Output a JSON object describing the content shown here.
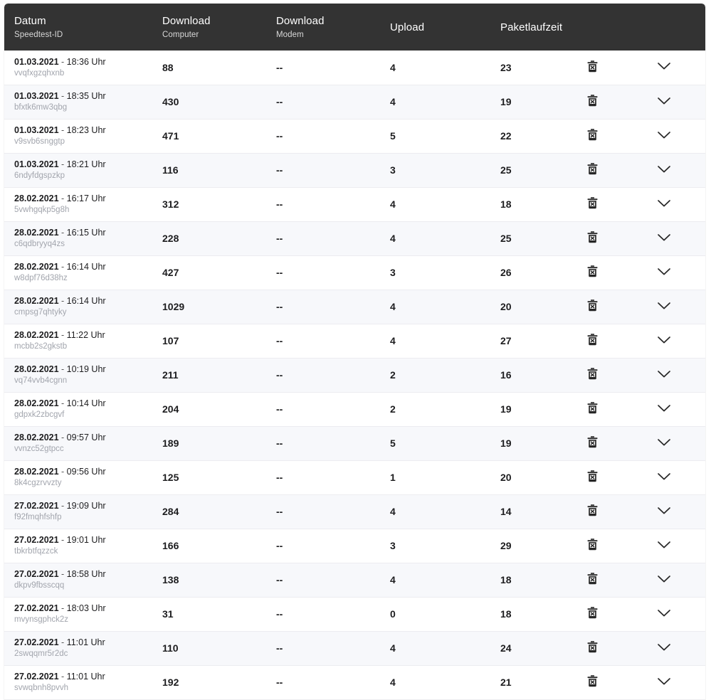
{
  "table": {
    "columns": [
      {
        "key": "datum",
        "main": "Datum",
        "sub": "Speedtest-ID"
      },
      {
        "key": "dl_comp",
        "main": "Download",
        "sub": "Computer"
      },
      {
        "key": "dl_modem",
        "main": "Download",
        "sub": "Modem"
      },
      {
        "key": "upload",
        "main": "Upload",
        "sub": ""
      },
      {
        "key": "latency",
        "main": "Paketlaufzeit",
        "sub": ""
      }
    ],
    "time_suffix": "Uhr",
    "separator": "-",
    "icons": {
      "delete": "trash-x-icon",
      "expand": "chevron-down-icon"
    },
    "rows": [
      {
        "date": "01.03.2021",
        "time": "18:36",
        "id": "vvqfxgzqhxnb",
        "dl_comp": "88",
        "dl_modem": "--",
        "upload": "4",
        "latency": "23"
      },
      {
        "date": "01.03.2021",
        "time": "18:35",
        "id": "bfxtk6mw3qbg",
        "dl_comp": "430",
        "dl_modem": "--",
        "upload": "4",
        "latency": "19"
      },
      {
        "date": "01.03.2021",
        "time": "18:23",
        "id": "v9svb6snggtp",
        "dl_comp": "471",
        "dl_modem": "--",
        "upload": "5",
        "latency": "22"
      },
      {
        "date": "01.03.2021",
        "time": "18:21",
        "id": "6ndyfdgspzkp",
        "dl_comp": "116",
        "dl_modem": "--",
        "upload": "3",
        "latency": "25"
      },
      {
        "date": "28.02.2021",
        "time": "16:17",
        "id": "5vwhgqkp5g8h",
        "dl_comp": "312",
        "dl_modem": "--",
        "upload": "4",
        "latency": "18"
      },
      {
        "date": "28.02.2021",
        "time": "16:15",
        "id": "c6qdbryyq4zs",
        "dl_comp": "228",
        "dl_modem": "--",
        "upload": "4",
        "latency": "25"
      },
      {
        "date": "28.02.2021",
        "time": "16:14",
        "id": "w8dpf76d38hz",
        "dl_comp": "427",
        "dl_modem": "--",
        "upload": "3",
        "latency": "26"
      },
      {
        "date": "28.02.2021",
        "time": "16:14",
        "id": "cmpsg7qhtyky",
        "dl_comp": "1029",
        "dl_modem": "--",
        "upload": "4",
        "latency": "20"
      },
      {
        "date": "28.02.2021",
        "time": "11:22",
        "id": "mcbb2s2gkstb",
        "dl_comp": "107",
        "dl_modem": "--",
        "upload": "4",
        "latency": "27"
      },
      {
        "date": "28.02.2021",
        "time": "10:19",
        "id": "vq74vvb4cgnn",
        "dl_comp": "211",
        "dl_modem": "--",
        "upload": "2",
        "latency": "16"
      },
      {
        "date": "28.02.2021",
        "time": "10:14",
        "id": "gdpxk2zbcgvf",
        "dl_comp": "204",
        "dl_modem": "--",
        "upload": "2",
        "latency": "19"
      },
      {
        "date": "28.02.2021",
        "time": "09:57",
        "id": "vvnzc52gtpcc",
        "dl_comp": "189",
        "dl_modem": "--",
        "upload": "5",
        "latency": "19"
      },
      {
        "date": "28.02.2021",
        "time": "09:56",
        "id": "8k4cgzrvvzty",
        "dl_comp": "125",
        "dl_modem": "--",
        "upload": "1",
        "latency": "20"
      },
      {
        "date": "27.02.2021",
        "time": "19:09",
        "id": "f92fmqhfshfp",
        "dl_comp": "284",
        "dl_modem": "--",
        "upload": "4",
        "latency": "14"
      },
      {
        "date": "27.02.2021",
        "time": "19:01",
        "id": "tbkrbtfqzzck",
        "dl_comp": "166",
        "dl_modem": "--",
        "upload": "3",
        "latency": "29"
      },
      {
        "date": "27.02.2021",
        "time": "18:58",
        "id": "dkpv9fbsscqq",
        "dl_comp": "138",
        "dl_modem": "--",
        "upload": "4",
        "latency": "18"
      },
      {
        "date": "27.02.2021",
        "time": "18:03",
        "id": "mvynsgphck2z",
        "dl_comp": "31",
        "dl_modem": "--",
        "upload": "0",
        "latency": "18"
      },
      {
        "date": "27.02.2021",
        "time": "11:01",
        "id": "2swqqmr5r2dc",
        "dl_comp": "110",
        "dl_modem": "--",
        "upload": "4",
        "latency": "24"
      },
      {
        "date": "27.02.2021",
        "time": "11:01",
        "id": "svwqbnh8pvvh",
        "dl_comp": "192",
        "dl_modem": "--",
        "upload": "4",
        "latency": "21"
      }
    ]
  },
  "colors": {
    "header_bg": "#333333",
    "row_odd": "#ffffff",
    "row_even": "#f7f8fb",
    "text": "#1d1d1f",
    "muted": "#a2a5ad",
    "border": "#ececf0"
  }
}
